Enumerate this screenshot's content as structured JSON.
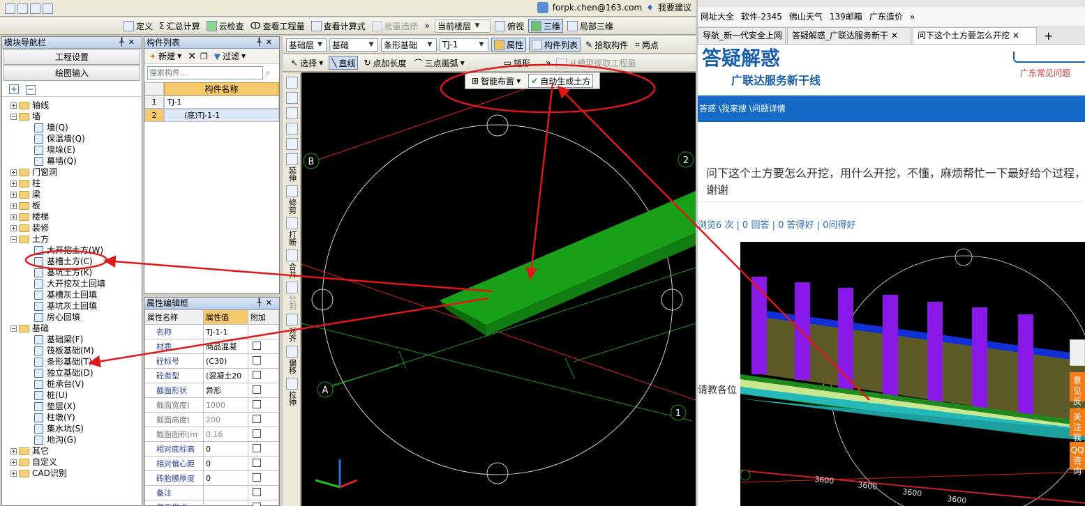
{
  "app": {
    "account_email": "forpk.chen@163.com",
    "suggest_label": "我要建议",
    "toolbar1": {
      "define": "定义",
      "summary_calc": "汇总计算",
      "cloud_check": "云检查",
      "view_quantity": "查看工程量",
      "view_formula": "查看计算式",
      "batch_select": "批量选择",
      "current_floor": "当前楼层",
      "top_view": "俯视",
      "three_d": "三维",
      "local_3d": "局部三维"
    },
    "nav_panel": {
      "title": "模块导航栏",
      "project_settings": "工程设置",
      "drawing_input": "绘图输入",
      "tree": [
        {
          "label": "轴线",
          "level": 0,
          "type": "folder",
          "expanded": false
        },
        {
          "label": "墙",
          "level": 0,
          "type": "folder",
          "expanded": true
        },
        {
          "label": "墙(Q)",
          "level": 1,
          "type": "leaf"
        },
        {
          "label": "保温墙(Q)",
          "level": 1,
          "type": "leaf"
        },
        {
          "label": "墙垛(E)",
          "level": 1,
          "type": "leaf"
        },
        {
          "label": "幕墙(Q)",
          "level": 1,
          "type": "leaf"
        },
        {
          "label": "门窗洞",
          "level": 0,
          "type": "folder",
          "expanded": false
        },
        {
          "label": "柱",
          "level": 0,
          "type": "folder",
          "expanded": false
        },
        {
          "label": "梁",
          "level": 0,
          "type": "folder",
          "expanded": false
        },
        {
          "label": "板",
          "level": 0,
          "type": "folder",
          "expanded": false
        },
        {
          "label": "楼梯",
          "level": 0,
          "type": "folder",
          "expanded": false
        },
        {
          "label": "装修",
          "level": 0,
          "type": "folder",
          "expanded": false
        },
        {
          "label": "土方",
          "level": 0,
          "type": "folder",
          "expanded": true
        },
        {
          "label": "大开挖土方(W)",
          "level": 1,
          "type": "leaf"
        },
        {
          "label": "基槽土方(C)",
          "level": 1,
          "type": "leaf"
        },
        {
          "label": "基坑土方(K)",
          "level": 1,
          "type": "leaf"
        },
        {
          "label": "大开挖灰土回填",
          "level": 1,
          "type": "leaf"
        },
        {
          "label": "基槽灰土回填",
          "level": 1,
          "type": "leaf"
        },
        {
          "label": "基坑灰土回填",
          "level": 1,
          "type": "leaf"
        },
        {
          "label": "房心回填",
          "level": 1,
          "type": "leaf"
        },
        {
          "label": "基础",
          "level": 0,
          "type": "folder",
          "expanded": true
        },
        {
          "label": "基础梁(F)",
          "level": 1,
          "type": "leaf"
        },
        {
          "label": "筏板基础(M)",
          "level": 1,
          "type": "leaf"
        },
        {
          "label": "条形基础(T)",
          "level": 1,
          "type": "leaf"
        },
        {
          "label": "独立基础(D)",
          "level": 1,
          "type": "leaf"
        },
        {
          "label": "桩承台(V)",
          "level": 1,
          "type": "leaf"
        },
        {
          "label": "桩(U)",
          "level": 1,
          "type": "leaf"
        },
        {
          "label": "垫层(X)",
          "level": 1,
          "type": "leaf"
        },
        {
          "label": "柱墩(Y)",
          "level": 1,
          "type": "leaf"
        },
        {
          "label": "集水坑(S)",
          "level": 1,
          "type": "leaf"
        },
        {
          "label": "地沟(G)",
          "level": 1,
          "type": "leaf"
        },
        {
          "label": "其它",
          "level": 0,
          "type": "folder",
          "expanded": false
        },
        {
          "label": "自定义",
          "level": 0,
          "type": "folder",
          "expanded": false
        },
        {
          "label": "CAD识别",
          "level": 0,
          "type": "folder",
          "expanded": false
        }
      ]
    },
    "component_list": {
      "title": "构件列表",
      "new_label": "新建",
      "filter_label": "过滤",
      "search_placeholder": "搜索构件...",
      "column": "构件名称",
      "rows": [
        {
          "num": "1",
          "name": "TJ-1"
        },
        {
          "num": "2",
          "name": "(底)TJ-1-1"
        }
      ]
    },
    "props": {
      "title": "属性编辑框",
      "headers": [
        "属性名称",
        "属性值",
        "附加"
      ],
      "rows": [
        {
          "name": "名称",
          "value": "TJ-1-1",
          "grey": false
        },
        {
          "name": "材质",
          "value": "商品混凝",
          "grey": false
        },
        {
          "name": "砼标号",
          "value": "(C30)",
          "grey": false
        },
        {
          "name": "砼类型",
          "value": "(混凝土20",
          "grey": false
        },
        {
          "name": "截面形状",
          "value": "异形",
          "grey": false
        },
        {
          "name": "截面宽度(",
          "value": "1000",
          "grey": true
        },
        {
          "name": "截面高度(",
          "value": "200",
          "grey": true
        },
        {
          "name": "截面面积(m",
          "value": "0.16",
          "grey": true
        },
        {
          "name": "相对底标高",
          "value": "0",
          "grey": false
        },
        {
          "name": "相对偏心距",
          "value": "0",
          "grey": false
        },
        {
          "name": "砖胎膜厚度",
          "value": "0",
          "grey": false
        },
        {
          "name": "备注",
          "value": "",
          "grey": false
        },
        {
          "name": "显示样式",
          "value": "",
          "grey": false
        }
      ]
    },
    "toolbar2": {
      "layer": "基础层",
      "category": "基础",
      "type": "条形基础",
      "component": "TJ-1",
      "attributes": "属性",
      "component_list": "构件列表",
      "pick": "拾取构件",
      "two_points": "两点"
    },
    "toolbar3": {
      "select": "选择",
      "line": "直线",
      "point_length": "点加长度",
      "three_point_arc": "三点画弧",
      "rect": "矩形",
      "extract": "从模型提取工程量"
    },
    "popup": {
      "smart_layout": "智能布置",
      "auto_generate": "自动生成土方"
    },
    "vtools": [
      "延伸",
      "修剪",
      "打断",
      "合并",
      "分割",
      "对齐",
      "偏移",
      "拉伸"
    ],
    "axis_labels": [
      "B",
      "2",
      "A",
      "1"
    ]
  },
  "browser": {
    "bookmarks": [
      "网址大全",
      "软件-2345",
      "佛山天气",
      "139邮箱",
      "广东造价"
    ],
    "tabs": [
      {
        "label": "导航_新一代安全上网",
        "active": false
      },
      {
        "label": "答疑解惑_广联达服务新干",
        "active": false
      },
      {
        "label": "问下这个土方要怎么开挖",
        "active": true
      }
    ],
    "site_title": "答疑解惑",
    "site_subtitle": "广联达服务新干线",
    "link_faq": "广东常见问题",
    "breadcrumb": "答惑 \\我来搜 \\问题详情",
    "question": "问下这个土方要怎么开挖，用什么开挖，不懂，麻烦帮忙一下最好给个过程，谢谢",
    "meta": "浏览6 次 | 0 回答 | 0 答得好 | 0问得好",
    "partial_text": "请教各位",
    "side_tabs": [
      "意见反馈",
      "关注我们",
      "QQ咨询"
    ],
    "dimension_labels": [
      "3600",
      "3600",
      "3600",
      "3600"
    ]
  },
  "colors": {
    "accent_blue": "#1569c7",
    "annotation_red": "#e01818",
    "foundation_green": "#1a9a1a",
    "side_orange": "#f07d1a"
  }
}
